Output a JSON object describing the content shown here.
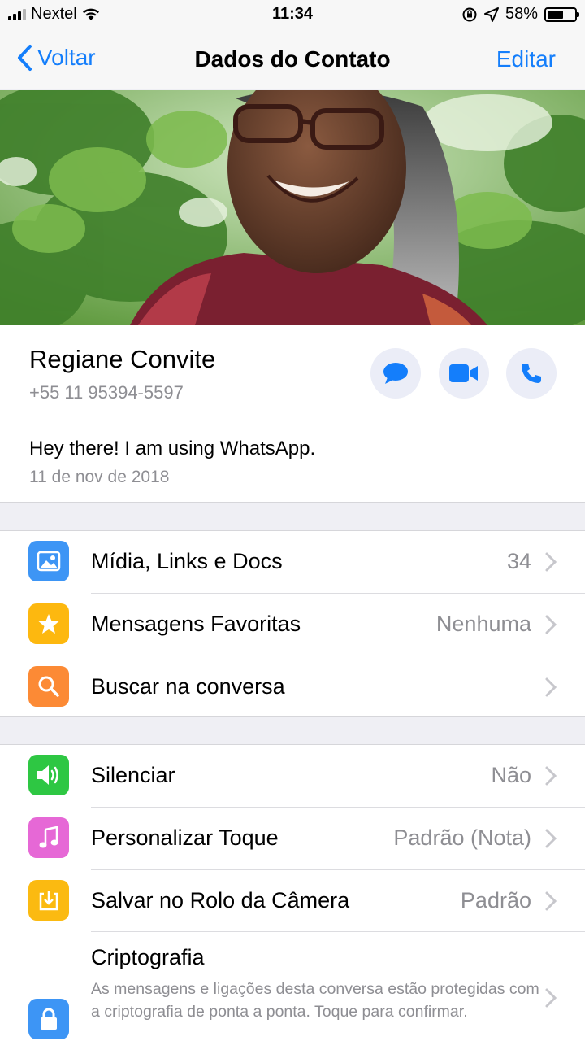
{
  "status_bar": {
    "carrier": "Nextel",
    "time": "11:34",
    "battery_percent": "58%",
    "battery_level": 0.58
  },
  "nav": {
    "back_label": "Voltar",
    "title": "Dados do Contato",
    "edit_label": "Editar"
  },
  "contact": {
    "name": "Regiane Convite",
    "phone": "+55 11 95394-5597",
    "status": "Hey there! I am using WhatsApp.",
    "status_date": "11 de nov de 2018"
  },
  "actions": [
    "message-icon",
    "video-call-icon",
    "voice-call-icon"
  ],
  "section1": [
    {
      "label": "Mídia, Links e Docs",
      "value": "34",
      "icon": "photo-icon",
      "color": "#3d95f5"
    },
    {
      "label": "Mensagens Favoritas",
      "value": "Nenhuma",
      "icon": "star-icon",
      "color": "#fdb80f"
    },
    {
      "label": "Buscar na conversa",
      "value": "",
      "icon": "search-icon",
      "color": "#fc8a35"
    }
  ],
  "section2": [
    {
      "label": "Silenciar",
      "value": "Não",
      "icon": "speaker-icon",
      "color": "#2ec743"
    },
    {
      "label": "Personalizar Toque",
      "value": "Padrão (Nota)",
      "icon": "music-note-icon",
      "color": "#e668d6"
    },
    {
      "label": "Salvar no Rolo da Câmera",
      "value": "Padrão",
      "icon": "download-icon",
      "color": "#fbba11"
    }
  ],
  "crypto": {
    "title": "Criptografia",
    "description": "As mensagens e ligações desta conversa estão protegidas com a criptografia de ponta a ponta. Toque para confirmar.",
    "icon": "lock-icon",
    "color": "#3d95f5"
  },
  "colors": {
    "accent": "#147efb",
    "background": "#efeff4",
    "secondary_text": "#8e8e93"
  }
}
